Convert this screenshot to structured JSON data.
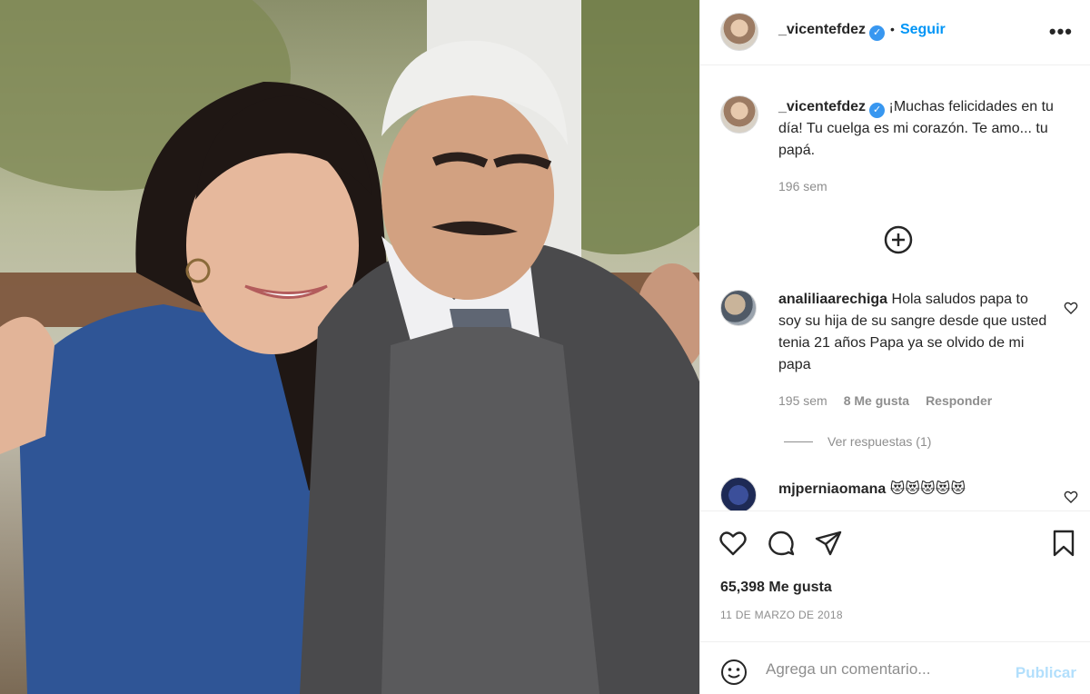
{
  "post": {
    "photo_alt": "photo",
    "username": "_vicentefdez",
    "verified_mark": "✓",
    "dot": "•",
    "follow_label": "Seguir",
    "more_label": "•••"
  },
  "caption": {
    "username": "_vicentefdez",
    "text": "¡Muchas felicidades en tu día! Tu cuelga es mi corazón. Te amo... tu papá.",
    "time": "196 sem"
  },
  "comments": [
    {
      "username": "analiliaarechiga",
      "text": "Hola saludos papa to soy su hija de su sangre desde que usted tenia 21 años Papa ya se olvido de mi papa",
      "time": "195 sem",
      "likes": "8 Me gusta",
      "reply_label": "Responder",
      "view_replies": "Ver respuestas (1)"
    },
    {
      "username": "mjperniaomana",
      "text": "😻😻😻😻😻"
    }
  ],
  "stats": {
    "likes": "65,398 Me gusta",
    "date": "11 DE MARZO DE 2018"
  },
  "composer": {
    "placeholder": "Agrega un comentario...",
    "publish_label": "Publicar"
  },
  "icons": [
    "heart-icon",
    "comment-icon",
    "share-icon",
    "bookmark-icon",
    "emoji-icon",
    "plus-circle-icon"
  ],
  "colors": {
    "accent": "#0095f6",
    "publish_disabled": "#b2dffc",
    "verified": "#3897f0",
    "muted": "#8e8e8e",
    "text": "#262626"
  }
}
